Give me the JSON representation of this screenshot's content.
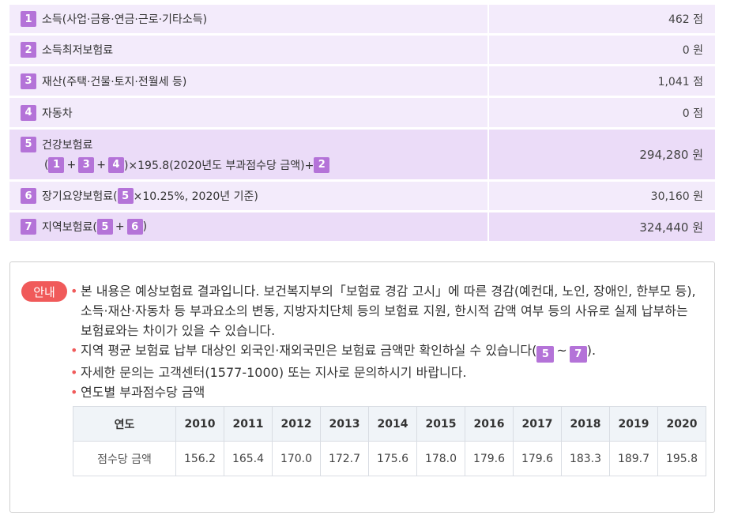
{
  "rows": [
    {
      "num": "1",
      "label": "소득(사업·금융·연금·근로·기타소득)",
      "value": "462 점"
    },
    {
      "num": "2",
      "label": "소득최저보험료",
      "value": "0 원"
    },
    {
      "num": "3",
      "label": "재산(주택·건물·토지·전월세 등)",
      "value": "1,041 점"
    },
    {
      "num": "4",
      "label": "자동차",
      "value": "0 점"
    },
    {
      "num": "5",
      "label": "건강보험료",
      "value": "294,280 원",
      "formula": {
        "open": "(",
        "a": "1",
        "plus1": "+",
        "b": "3",
        "plus2": "+",
        "c": "4",
        "tail": ")×195.8(2020년도 부과점수당 금액)+",
        "d": "2"
      }
    },
    {
      "num": "6",
      "label": "장기요양보험료(",
      "ref": "5",
      "tail": "×10.25%, 2020년 기준)",
      "value": "30,160 원"
    },
    {
      "num": "7",
      "label": "지역보험료(",
      "ref1": "5",
      "plus": "+",
      "ref2": "6",
      "close": ")",
      "value": "324,440 원"
    }
  ],
  "notice": {
    "badge": "안내",
    "item1": "본 내용은 예상보험료 결과입니다. 보건복지부의「보험료 경감 고시」에 따른 경감(예컨대, 노인, 장애인, 한부모 등), 소득·재산·자동차 등 부과요소의 변동, 지방자치단체 등의 보험료 지원, 한시적 감액 여부 등의 사유로 실제 납부하는 보험료와는 차이가 있을 수 있습니다.",
    "item2_text": "지역 평균 보험료 납부 대상인 외국인·재외국민은 보험료 금액만 확인하실 수 있습니다(",
    "item2_from": "5",
    "item2_tilde": "~",
    "item2_to": "7",
    "item2_end": ").",
    "item3": "자세한 문의는 고객센터(1577-1000) 또는 지사로 문의하시기 바랍니다.",
    "item4": "연도별 부과점수당 금액",
    "bullet": "•"
  },
  "year_table": {
    "header_label": "연도",
    "row_label": "점수당 금액",
    "years": [
      "2010",
      "2011",
      "2012",
      "2013",
      "2014",
      "2015",
      "2016",
      "2017",
      "2018",
      "2019",
      "2020"
    ],
    "values": [
      "156.2",
      "165.4",
      "170.0",
      "172.7",
      "175.6",
      "178.0",
      "179.6",
      "179.6",
      "183.3",
      "189.7",
      "195.8"
    ]
  },
  "colors": {
    "number_badge": "#b473d8",
    "row_bg": "#f3ebfb",
    "row_highlight": "#ebdcf8",
    "notice_badge": "#f05a5a"
  }
}
